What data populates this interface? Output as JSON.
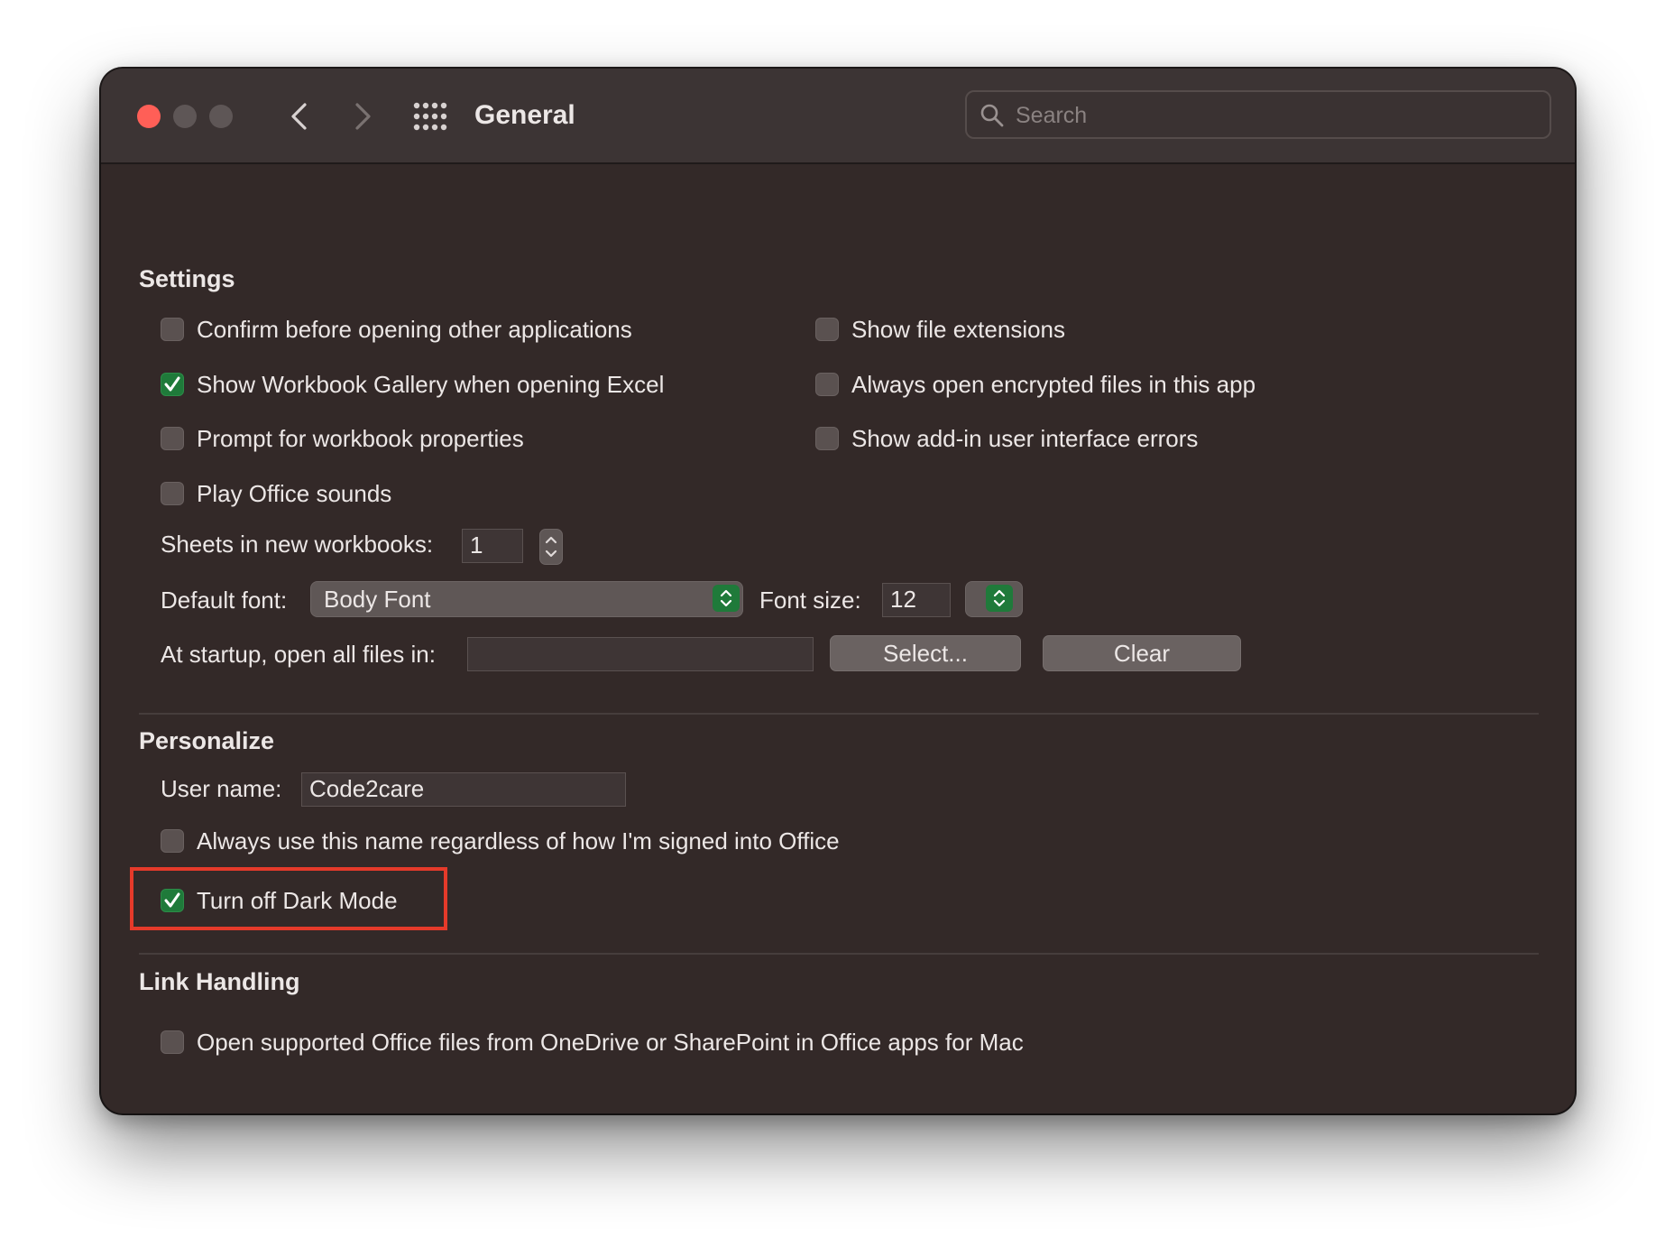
{
  "window": {
    "title": "General",
    "search_placeholder": "Search"
  },
  "settings": {
    "heading": "Settings",
    "left_options": [
      {
        "label": "Confirm before opening other applications",
        "checked": false
      },
      {
        "label": "Show Workbook Gallery when opening Excel",
        "checked": true
      },
      {
        "label": "Prompt for workbook properties",
        "checked": false
      },
      {
        "label": "Play Office sounds",
        "checked": false
      }
    ],
    "right_options": [
      {
        "label": "Show file extensions",
        "checked": false
      },
      {
        "label": "Always open encrypted files in this app",
        "checked": false
      },
      {
        "label": "Show add-in user interface errors",
        "checked": false
      }
    ],
    "sheets_label": "Sheets in new workbooks:",
    "sheets_value": "1",
    "default_font_label": "Default font:",
    "default_font_value": "Body Font",
    "font_size_label": "Font size:",
    "font_size_value": "12",
    "startup_label": "At startup, open all files in:",
    "startup_value": "",
    "select_button": "Select...",
    "clear_button": "Clear"
  },
  "personalize": {
    "heading": "Personalize",
    "user_name_label": "User name:",
    "user_name_value": "Code2care",
    "always_use_name": {
      "label": "Always use this name regardless of how I'm signed into Office",
      "checked": false
    },
    "dark_mode": {
      "label": "Turn off Dark Mode",
      "checked": true
    }
  },
  "link_handling": {
    "heading": "Link Handling",
    "open_supported": {
      "label": "Open supported Office files from OneDrive or SharePoint in Office apps for Mac",
      "checked": false
    }
  },
  "colors": {
    "window_bg": "#332928",
    "check_accent": "#1f7a3a",
    "highlight": "#e53a2a"
  }
}
